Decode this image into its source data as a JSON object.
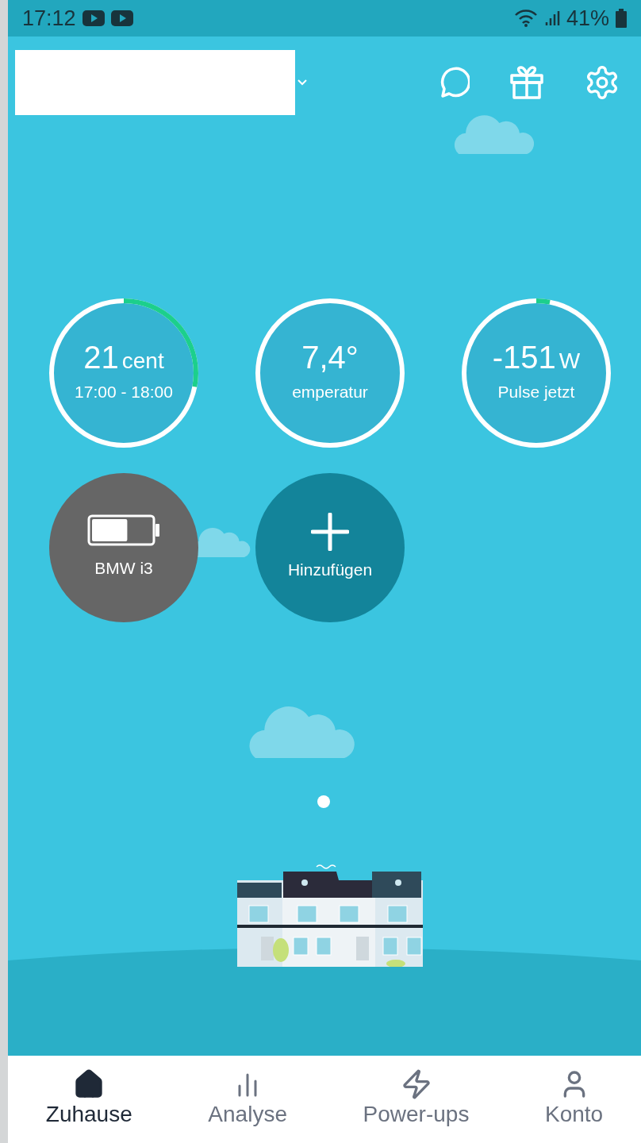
{
  "status_bar": {
    "time": "17:12",
    "battery": "41%"
  },
  "gauges": [
    {
      "value": "21",
      "unit": "cent",
      "caption": "17:00 - 18:00",
      "level": 0.28
    },
    {
      "value": "7,4°",
      "caption": "emperatur"
    },
    {
      "value": "-151",
      "unit": "W",
      "caption": "Pulse jetzt",
      "level": 0.03
    }
  ],
  "tiles": [
    {
      "kind": "vehicle",
      "label": "BMW i3",
      "level": 0.6
    },
    {
      "kind": "add",
      "label": "Hinzufügen"
    }
  ],
  "carousel": {
    "pages": [
      {
        "selected": true
      }
    ]
  },
  "bottom_nav": [
    {
      "label": "Zuhause",
      "kind": "home",
      "selected": true
    },
    {
      "label": "Analyse",
      "kind": "chart",
      "selected": false
    },
    {
      "label": "Power-ups",
      "kind": "bolt",
      "selected": false
    },
    {
      "label": "Konto",
      "kind": "user",
      "selected": false
    }
  ]
}
